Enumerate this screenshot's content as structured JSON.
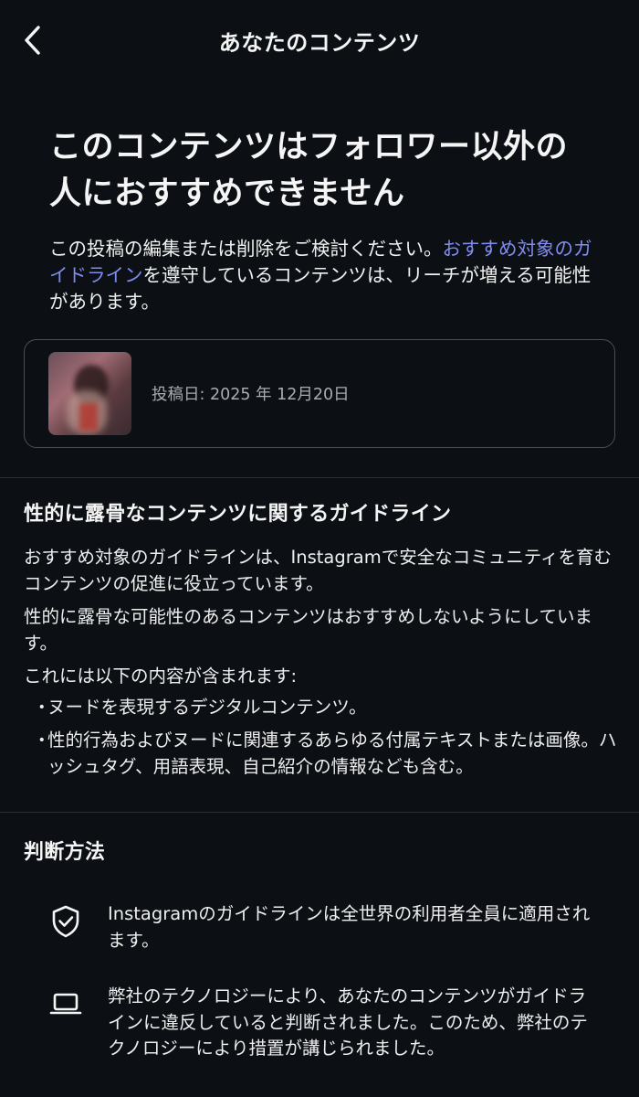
{
  "header": {
    "title": "あなたのコンテンツ"
  },
  "hero": {
    "title_line1": "このコンテンツはフォロワー以外の",
    "title_line2": "人におすすめできません",
    "desc_before": "この投稿の編集または削除をご検討ください。",
    "desc_link": "おすすめ対象のガイドライン",
    "desc_after": "を遵守しているコンテンツは、リーチが増える可能性があります。"
  },
  "post": {
    "date_label": "投稿日: 2025 年 12月20日"
  },
  "guidelines": {
    "title": "性的に露骨なコンテンツに関するガイドライン",
    "para1": "おすすめ対象のガイドラインは、Instagramで安全なコミュニティを育むコンテンツの促進に役立っています。",
    "para2": "性的に露骨な可能性のあるコンテンツはおすすめしないようにしています。",
    "para3": "これには以下の内容が含まれます:",
    "bullets": [
      "ヌードを表現するデジタルコンテンツ。",
      "性的行為およびヌードに関連するあらゆる付属テキストまたは画像。ハッシュタグ、用語表現、自己紹介の情報なども含む。"
    ],
    "bullet_mark": "・"
  },
  "method": {
    "title": "判断方法",
    "items": [
      {
        "icon": "shield-check-icon",
        "text": "Instagramのガイドラインは全世界の利用者全員に適用されます。"
      },
      {
        "icon": "laptop-icon",
        "text": "弊社のテクノロジーにより、あなたのコンテンツがガイドラインに違反していると判断されました。このため、弊社のテクノロジーにより措置が講じられました。"
      }
    ]
  },
  "colors": {
    "background": "#0c1014",
    "link": "#7f8cf2",
    "muted": "#a8adb3"
  }
}
